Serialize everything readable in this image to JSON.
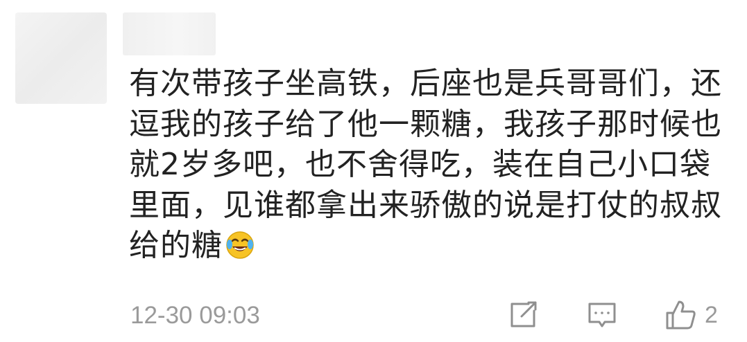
{
  "comment": {
    "lines": [
      "有次带孩子坐高铁，后座也是兵哥哥们，还",
      "逗我的孩子给了他一颗糖，我孩子那时候也",
      "就2岁多吧，也不舍得吃，装在自己小口袋",
      "里面，见谁都拿出来骄傲的说是打仗的叔叔",
      "给的糖"
    ],
    "emoji": "laughing-crying-emoji"
  },
  "meta": {
    "timestamp": "12-30 09:03",
    "like_count": "2"
  },
  "icons": {
    "share": "share-icon",
    "reply": "comment-icon",
    "like": "thumbs-up-icon"
  },
  "colors": {
    "text": "#222222",
    "muted": "#9a9a9a",
    "emoji_face": "#f7c325"
  }
}
